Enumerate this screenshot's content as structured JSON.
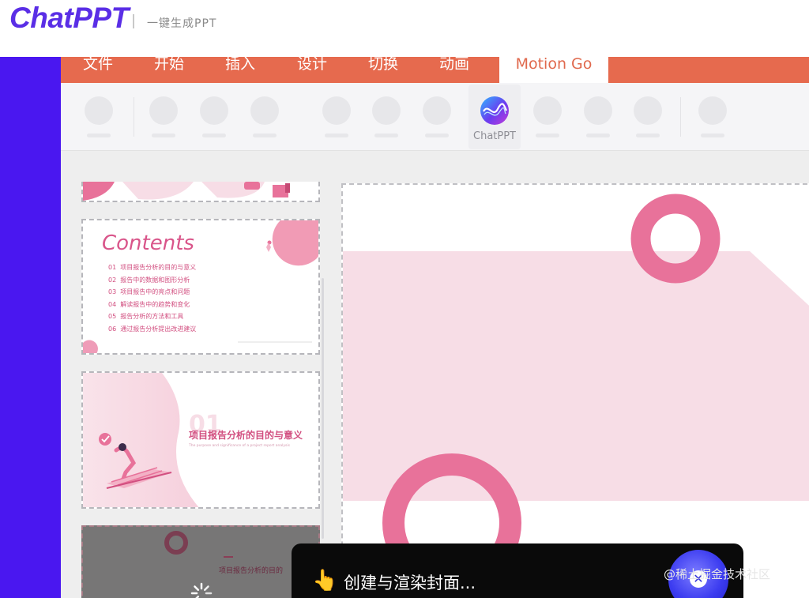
{
  "header": {
    "logo": "ChatPPT",
    "tagline": "一键生成PPT"
  },
  "ribbon": {
    "tabs": [
      "文件",
      "开始",
      "插入",
      "设计",
      "切换",
      "动画"
    ],
    "active_tab": "Motion Go"
  },
  "toolbar": {
    "chatppt_label": "ChatPPT"
  },
  "slides": {
    "contents_title": "Contents",
    "contents_items": [
      {
        "num": "01",
        "text": "项目报告分析的目的与意义"
      },
      {
        "num": "02",
        "text": "报告中的数据和图形分析"
      },
      {
        "num": "03",
        "text": "项目报告中的亮点和问题"
      },
      {
        "num": "04",
        "text": "解读报告中的趋势和变化"
      },
      {
        "num": "05",
        "text": "报告分析的方法和工具"
      },
      {
        "num": "06",
        "text": "通过报告分析提出改进建议"
      }
    ],
    "section_number": "01",
    "section_title": "项目报告分析的目的与意义",
    "section_subtitle": "The purpose and significance of a project report analysis",
    "slide4_title": "项目报告分析的目的"
  },
  "toast": {
    "icon": "pointing-hand-icon",
    "message": "创建与渲染封面...",
    "close_icon": "close-icon"
  },
  "watermark": "@稀土掘金技术社区",
  "colors": {
    "brand_purple": "#5a2ee6",
    "sidebar_purple": "#4a17f0",
    "ribbon_orange": "#e66a4e",
    "slide_pink": "#e8729a",
    "slide_light_pink": "#f7dde6"
  }
}
